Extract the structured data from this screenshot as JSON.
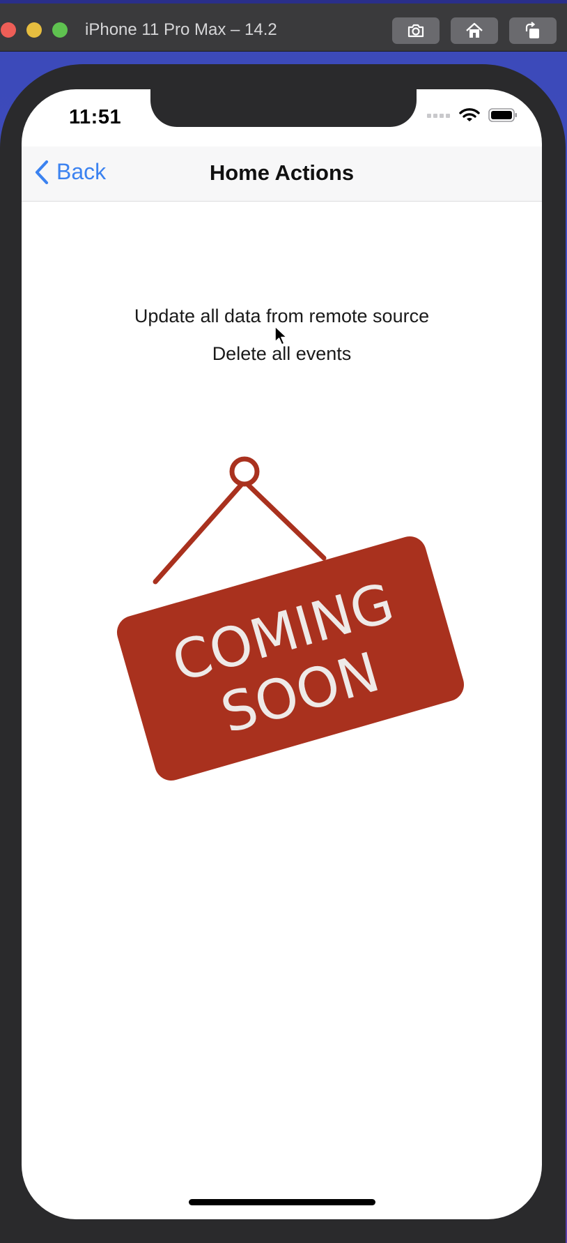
{
  "window": {
    "title": "iPhone 11 Pro Max – 14.2",
    "buttons": [
      {
        "name": "screenshot",
        "icon": "camera-icon"
      },
      {
        "name": "home",
        "icon": "home-icon"
      },
      {
        "name": "rotate",
        "icon": "rotate-icon"
      }
    ]
  },
  "status_bar": {
    "time": "11:51",
    "icons": [
      "cellular-signal-icon",
      "wifi-icon",
      "battery-icon"
    ]
  },
  "nav": {
    "back_label": "Back",
    "title": "Home Actions",
    "accent_color": "#3b82f0"
  },
  "actions": [
    {
      "label": "Update all data from remote source"
    },
    {
      "label": "Delete all events"
    }
  ],
  "sign": {
    "line1": "COMING",
    "line2": "SOON",
    "color": "#a9311e",
    "text_color": "#eeeae8"
  }
}
